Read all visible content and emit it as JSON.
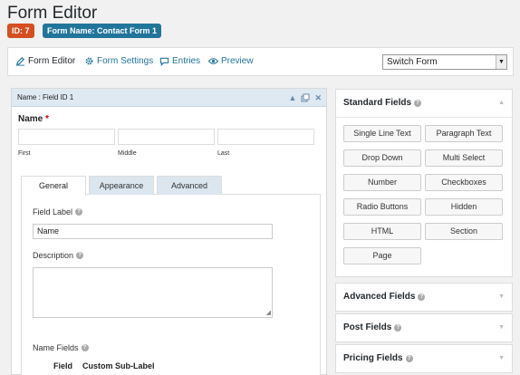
{
  "page": {
    "title": "Form Editor"
  },
  "badges": {
    "id": "ID: 7",
    "form_name": "Form Name: Contact Form 1"
  },
  "toolbar": {
    "form_editor": "Form Editor",
    "form_settings": "Form Settings",
    "entries": "Entries",
    "preview": "Preview",
    "switch_form": "Switch Form"
  },
  "field": {
    "header": "Name : Field ID 1",
    "title": "Name",
    "required_mark": "*",
    "sub_labels": {
      "first": "First",
      "middle": "Middle",
      "last": "Last"
    }
  },
  "tabs": {
    "general": "General",
    "appearance": "Appearance",
    "advanced": "Advanced"
  },
  "settings": {
    "field_label": "Field Label",
    "field_label_value": "Name",
    "description": "Description",
    "name_fields": "Name Fields",
    "col_field": "Field",
    "col_custom_sub_label": "Custom Sub-Label"
  },
  "sidebar": {
    "standard_fields": "Standard Fields",
    "advanced_fields": "Advanced Fields",
    "post_fields": "Post Fields",
    "pricing_fields": "Pricing Fields",
    "buttons": [
      "Single Line Text",
      "Paragraph Text",
      "Drop Down",
      "Multi Select",
      "Number",
      "Checkboxes",
      "Radio Buttons",
      "Hidden",
      "HTML",
      "Section",
      "Page"
    ]
  },
  "colors": {
    "id_badge": "#d54e21",
    "name_badge": "#21759b",
    "link": "#21759b",
    "field_header": "#dfe9f2",
    "tab_inactive": "#dbe6ef"
  }
}
